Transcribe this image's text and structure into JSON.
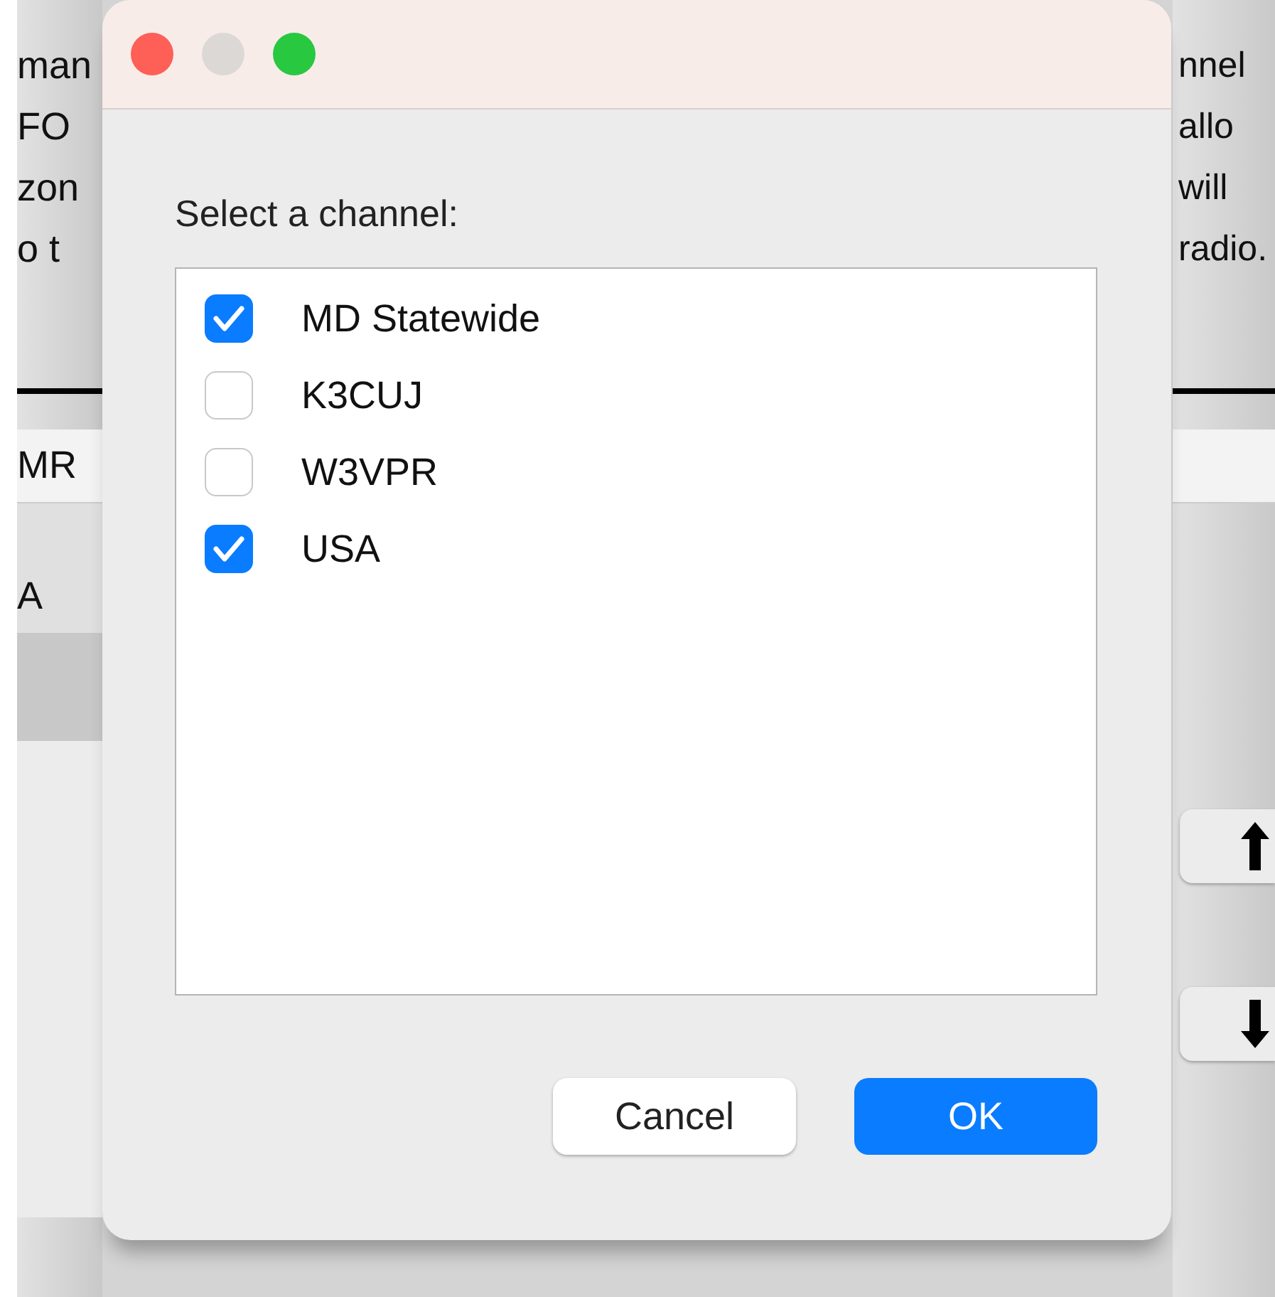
{
  "background": {
    "left_text": [
      "man",
      "FO",
      "zon",
      "o t"
    ],
    "left_fields": [
      "MR",
      "A"
    ],
    "right_text": [
      "nnel",
      "allo",
      "will",
      "radio."
    ]
  },
  "dialog": {
    "window_controls": [
      {
        "kind": "close"
      },
      {
        "kind": "minimize"
      },
      {
        "kind": "zoom"
      }
    ],
    "prompt": "Select a channel:",
    "channels": [
      {
        "label": "MD Statewide",
        "checked": true
      },
      {
        "label": "K3CUJ",
        "checked": false
      },
      {
        "label": "W3VPR",
        "checked": false
      },
      {
        "label": "USA",
        "checked": true
      }
    ],
    "buttons": [
      {
        "label": "Cancel",
        "kind": "normal"
      },
      {
        "label": "OK",
        "kind": "default"
      }
    ]
  }
}
